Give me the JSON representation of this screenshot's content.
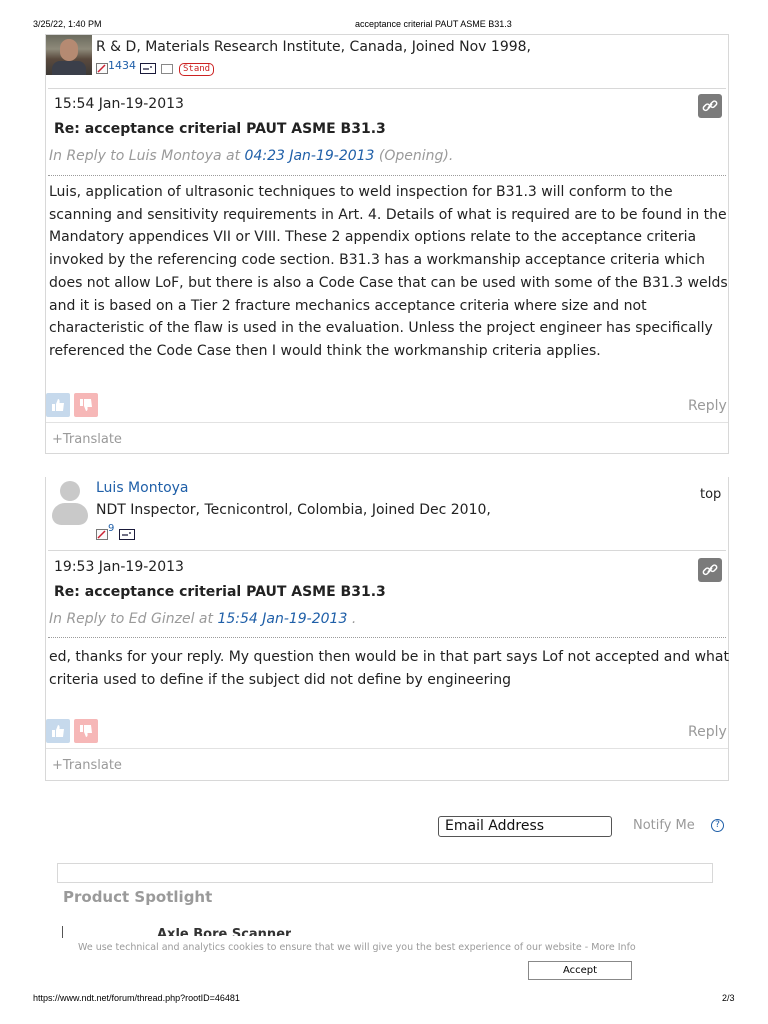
{
  "print_header": {
    "datetime": "3/25/22, 1:40 PM",
    "title": "acceptance criterial PAUT ASME B31.3"
  },
  "print_footer": {
    "url": "https://www.ndt.net/forum/thread.php?rootID=46481",
    "page": "2/3"
  },
  "post1": {
    "author_meta": "R & D, Materials Research Institute, Canada, Joined Nov 1998,",
    "post_count": "1434",
    "badge": "Stand",
    "time": "15:54 Jan-19-2013",
    "subject": "Re: acceptance criterial PAUT ASME B31.3",
    "reply_prefix": "In Reply to Luis Montoya at",
    "reply_time": "04:23 Jan-19-2013",
    "reply_suffix": "(Opening).",
    "body": [
      "Luis, application of ultrasonic techniques to weld inspection for B31.3 will conform to the",
      "scanning and sensitivity requirements in Art. 4. Details of what is required are to be found in the",
      "Mandatory appendices VII or VIII. These 2 appendix options relate to the acceptance criteria",
      "invoked by the referencing code section. B31.3 has a workmanship acceptance criteria which",
      "does not allow LoF, but there is also a Code Case that can be used with some of the B31.3 welds",
      "and it is based on a Tier 2 fracture mechanics acceptance criteria where size and not",
      "characteristic of the flaw is used in the evaluation. Unless the project engineer has specifically",
      "referenced the Code Case then I would think the workmanship criteria applies."
    ],
    "reply_label": "Reply",
    "translate_label": "+Translate"
  },
  "post2": {
    "author_name": "Luis Montoya",
    "top_label": "top",
    "author_meta": "NDT Inspector, Tecnicontrol, Colombia, Joined Dec 2010,",
    "post_count": "9",
    "time": "19:53 Jan-19-2013",
    "subject": "Re: acceptance criterial PAUT ASME B31.3",
    "reply_prefix": "In Reply to Ed Ginzel at",
    "reply_time": "15:54 Jan-19-2013",
    "reply_suffix": ".",
    "body": [
      "ed, thanks for your reply. My question then would be in that part says Lof not accepted and what",
      "criteria used to define if the subject did not define by engineering"
    ],
    "reply_label": "Reply",
    "translate_label": "+Translate"
  },
  "notify": {
    "email_placeholder": "Email Address",
    "notify_label": "Notify Me",
    "help_label": "?"
  },
  "spotlight": {
    "title": "Product Spotlight",
    "item_title": "Axle Bore Scanner"
  },
  "cookie": {
    "message": "We use technical and analytics cookies to ensure that we will give you the best experience of our website - More Info",
    "accept_label": "Accept"
  },
  "colors": {
    "link": "#1f5fa8",
    "muted": "#9a9a9a",
    "like": "#c6d9ec",
    "dislike": "#f6b7b7"
  }
}
